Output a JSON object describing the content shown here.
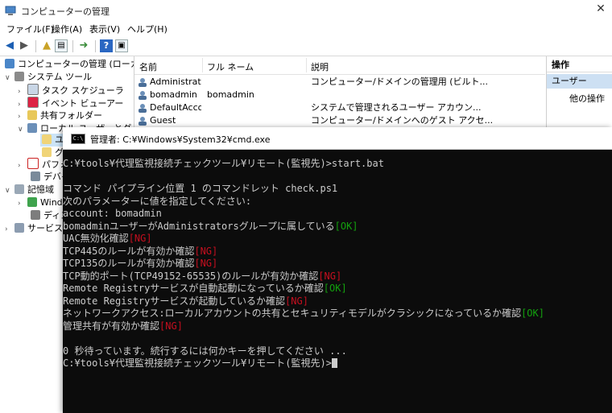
{
  "window": {
    "title": "コンピューターの管理",
    "close_glyph": "✕"
  },
  "menu": [
    "ファイル(F)",
    "操作(A)",
    "表示(V)",
    "ヘルプ(H)"
  ],
  "toolbar": {
    "help_glyph": "?"
  },
  "tree": {
    "items": [
      {
        "label": "コンピューターの管理 (ローカル)"
      },
      {
        "label": "システム ツール"
      },
      {
        "label": "タスク スケジューラ"
      },
      {
        "label": "イベント ビューアー"
      },
      {
        "label": "共有フォルダー"
      },
      {
        "label": "ローカル ユーザーとグループ"
      },
      {
        "label": "ユ"
      },
      {
        "label": "グ"
      },
      {
        "label": "パフォ"
      },
      {
        "label": "デバイ"
      },
      {
        "label": "記憶域"
      },
      {
        "label": "Wind"
      },
      {
        "label": "ディス"
      },
      {
        "label": "サービス"
      }
    ]
  },
  "list": {
    "columns": [
      "名前",
      "フル ネーム",
      "説明"
    ],
    "rows": [
      {
        "name": "Administrator",
        "fullname": "",
        "desc": "コンピューター/ドメインの管理用 (ビルト..."
      },
      {
        "name": "bomadmin",
        "fullname": "bomadmin",
        "desc": ""
      },
      {
        "name": "DefaultAcco...",
        "fullname": "",
        "desc": "システムで管理されるユーザー アカウン..."
      },
      {
        "name": "Guest",
        "fullname": "",
        "desc": "コンピューター/ドメインへのゲスト アクセ..."
      }
    ]
  },
  "actions": {
    "header": "操作",
    "selected": "ユーザー",
    "item": "他の操作"
  },
  "cmd": {
    "title": "管理者: C:¥Windows¥System32¥cmd.exe",
    "icon_text": "C:\\",
    "lines": [
      {
        "text": "C:¥tools¥代理監視接続チェックツール¥リモート(監視先)>start.bat",
        "tag": "",
        "tag_type": ""
      },
      {
        "text": "",
        "tag": "",
        "tag_type": ""
      },
      {
        "text": "コマンド パイプライン位置 1 のコマンドレット check.ps1",
        "tag": "",
        "tag_type": ""
      },
      {
        "text": "次のパラメーターに値を指定してください:",
        "tag": "",
        "tag_type": ""
      },
      {
        "text": "account: bomadmin",
        "tag": "",
        "tag_type": ""
      },
      {
        "text": "bomadminユーザーがAdministratorsグループに属している",
        "tag": "[OK]",
        "tag_type": "ok"
      },
      {
        "text": "UAC無効化確認",
        "tag": "[NG]",
        "tag_type": "ng"
      },
      {
        "text": "TCP445のルールが有効か確認",
        "tag": "[NG]",
        "tag_type": "ng"
      },
      {
        "text": "TCP135のルールが有効か確認",
        "tag": "[NG]",
        "tag_type": "ng"
      },
      {
        "text": "TCP動的ポート(TCP49152-65535)のルールが有効か確認",
        "tag": "[NG]",
        "tag_type": "ng"
      },
      {
        "text": "Remote Registryサービスが自動起動になっているか確認",
        "tag": "[OK]",
        "tag_type": "ok"
      },
      {
        "text": "Remote Registryサービスが起動しているか確認",
        "tag": "[NG]",
        "tag_type": "ng"
      },
      {
        "text": "ネットワークアクセス:ローカルアカウントの共有とセキュリティモデルがクラシックになっているか確認",
        "tag": "[OK]",
        "tag_type": "ok"
      },
      {
        "text": "管理共有が有効か確認",
        "tag": "[NG]",
        "tag_type": "ng"
      },
      {
        "text": "",
        "tag": "",
        "tag_type": ""
      },
      {
        "text": "0 秒待っています。続行するには何かキーを押してください ...",
        "tag": "",
        "tag_type": ""
      },
      {
        "text": "C:¥tools¥代理監視接続チェックツール¥リモート(監視先)>",
        "tag": "",
        "tag_type": ""
      }
    ]
  },
  "colors": {
    "console_bg": "#0c0c0c",
    "console_fg": "#cccccc",
    "ok": "#13a10e",
    "ng": "#c50f1f"
  }
}
